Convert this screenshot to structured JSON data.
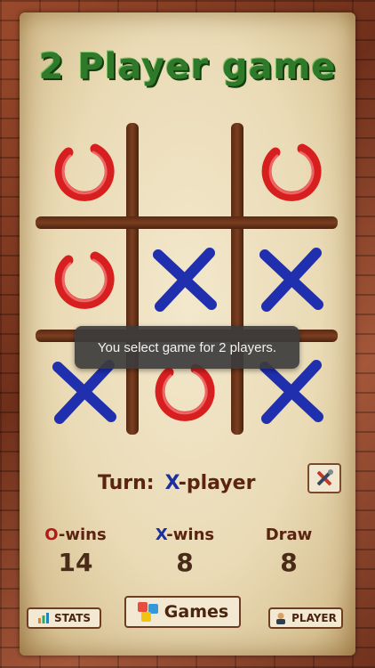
{
  "title": "2 Player game",
  "board": {
    "cells": [
      "O",
      "",
      "O",
      "O",
      "X",
      "X",
      "X",
      "O",
      "X"
    ]
  },
  "toast": "You select game for 2 players.",
  "turn": {
    "label": "Turn:",
    "player_symbol": "X",
    "player_suffix": "-player"
  },
  "stats": {
    "o_wins": {
      "label_symbol": "O",
      "label_suffix": "-wins",
      "value": "14"
    },
    "x_wins": {
      "label_symbol": "X",
      "label_suffix": "-wins",
      "value": "8"
    },
    "draw": {
      "label": "Draw",
      "value": "8"
    }
  },
  "buttons": {
    "stats": "STATS",
    "games": "Games",
    "player": "PLAYER"
  },
  "colors": {
    "o_mark": "#d81f1f",
    "x_mark": "#1f2fae",
    "title": "#2f7a2a"
  },
  "icons": {
    "settings": "tools-icon",
    "stats": "bar-chart-icon",
    "games": "games-icon",
    "player": "player-icon"
  }
}
